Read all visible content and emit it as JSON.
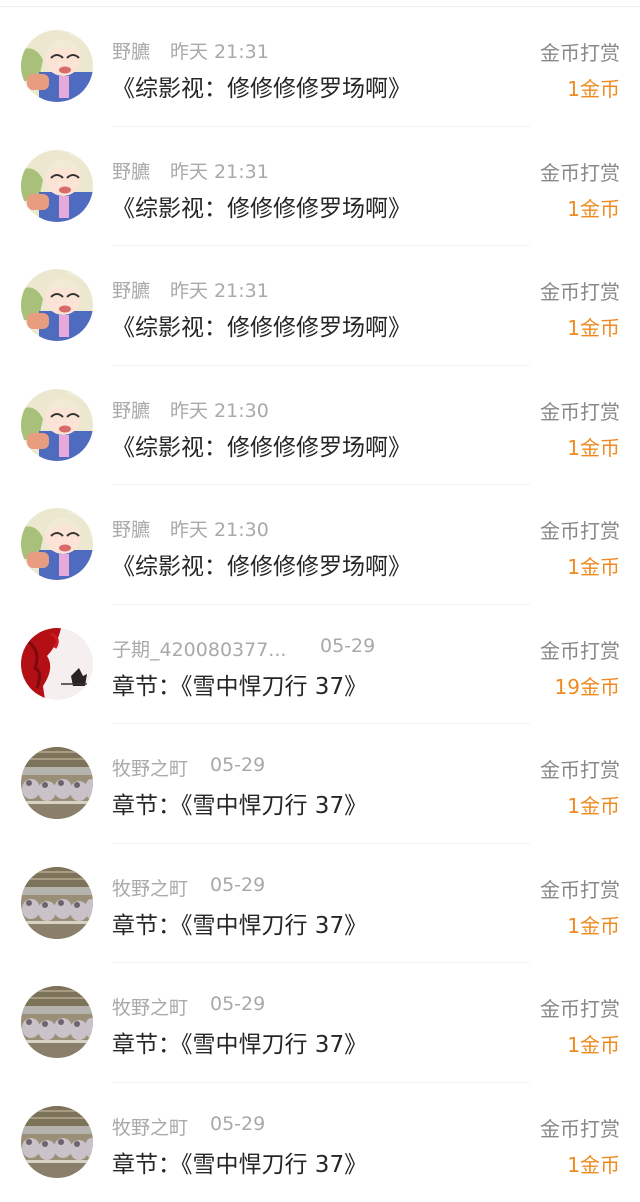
{
  "rows": [
    {
      "avatar": "cartoon-avatar",
      "user": "野臕",
      "time": "昨天 21:31",
      "title": "《综影视：修修修修罗场啊》",
      "reward_type": "金币打赏",
      "reward_amount": "1金币"
    },
    {
      "avatar": "cartoon-avatar",
      "user": "野臕",
      "time": "昨天 21:31",
      "title": "《综影视：修修修修罗场啊》",
      "reward_type": "金币打赏",
      "reward_amount": "1金币"
    },
    {
      "avatar": "cartoon-avatar",
      "user": "野臕",
      "time": "昨天 21:31",
      "title": "《综影视：修修修修罗场啊》",
      "reward_type": "金币打赏",
      "reward_amount": "1金币"
    },
    {
      "avatar": "cartoon-avatar",
      "user": "野臕",
      "time": "昨天 21:30",
      "title": "《综影视：修修修修罗场啊》",
      "reward_type": "金币打赏",
      "reward_amount": "1金币"
    },
    {
      "avatar": "cartoon-avatar",
      "user": "野臕",
      "time": "昨天 21:30",
      "title": "《综影视：修修修修罗场啊》",
      "reward_type": "金币打赏",
      "reward_amount": "1金币"
    },
    {
      "avatar": "red-ink-avatar",
      "user": "子期_420080377...",
      "time": "05-29",
      "title": "章节：《雪中悍刀行 37》",
      "reward_type": "金币打赏",
      "reward_amount": "19金币"
    },
    {
      "avatar": "photo-avatar",
      "user": "牧野之町",
      "time": "05-29",
      "title": "章节：《雪中悍刀行 37》",
      "reward_type": "金币打赏",
      "reward_amount": "1金币"
    },
    {
      "avatar": "photo-avatar",
      "user": "牧野之町",
      "time": "05-29",
      "title": "章节：《雪中悍刀行 37》",
      "reward_type": "金币打赏",
      "reward_amount": "1金币"
    },
    {
      "avatar": "photo-avatar",
      "user": "牧野之町",
      "time": "05-29",
      "title": "章节：《雪中悍刀行 37》",
      "reward_type": "金币打赏",
      "reward_amount": "1金币"
    },
    {
      "avatar": "photo-avatar",
      "user": "牧野之町",
      "time": "05-29",
      "title": "章节：《雪中悍刀行 37》",
      "reward_type": "金币打赏",
      "reward_amount": "1金币"
    }
  ],
  "colors": {
    "accent": "#ee8a1f",
    "meta_text": "#a9a9a9",
    "title_text": "#262626",
    "label_text": "#888888"
  }
}
